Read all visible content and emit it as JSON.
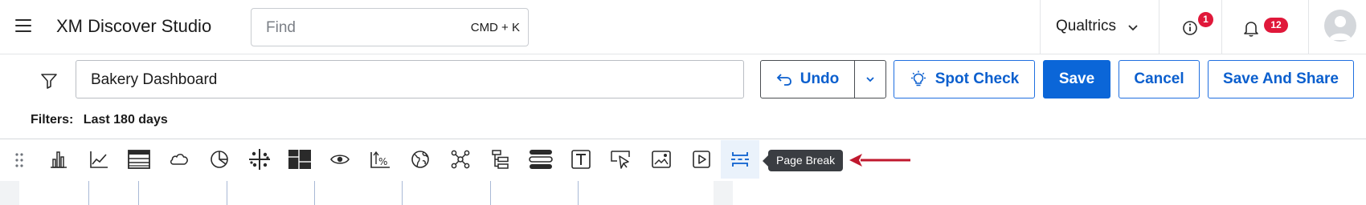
{
  "header": {
    "app_title": "XM Discover Studio",
    "find_placeholder": "Find",
    "find_shortcut": "CMD + K",
    "org_name": "Qualtrics",
    "info_badge": "1",
    "notifications_badge": "12"
  },
  "editor": {
    "dashboard_name": "Bakery Dashboard",
    "undo_label": "Undo",
    "spot_check_label": "Spot Check",
    "save_label": "Save",
    "cancel_label": "Cancel",
    "save_and_share_label": "Save And Share",
    "filters_label": "Filters:",
    "filters_value": "Last 180 days"
  },
  "toolbar": {
    "tools": [
      {
        "icon": "bar-chart-icon"
      },
      {
        "icon": "line-chart-icon"
      },
      {
        "icon": "table-icon"
      },
      {
        "icon": "cloud-icon"
      },
      {
        "icon": "pie-chart-icon"
      },
      {
        "icon": "scatter-icon"
      },
      {
        "icon": "heatmap-icon"
      },
      {
        "icon": "eye-icon"
      },
      {
        "icon": "metric-percent-icon"
      },
      {
        "icon": "globe-icon"
      },
      {
        "icon": "network-icon"
      },
      {
        "icon": "hierarchy-icon"
      },
      {
        "icon": "stacked-bars-icon"
      },
      {
        "icon": "text-icon"
      },
      {
        "icon": "cursor-icon"
      },
      {
        "icon": "image-icon"
      },
      {
        "icon": "video-icon"
      },
      {
        "icon": "page-break-icon",
        "active": true
      }
    ],
    "tooltip": "Page Break"
  },
  "colors": {
    "primary": "#0b66d8",
    "badge": "#e0183a",
    "annotation_arrow": "#c0182e",
    "tooltip_bg": "#3a3d42"
  }
}
